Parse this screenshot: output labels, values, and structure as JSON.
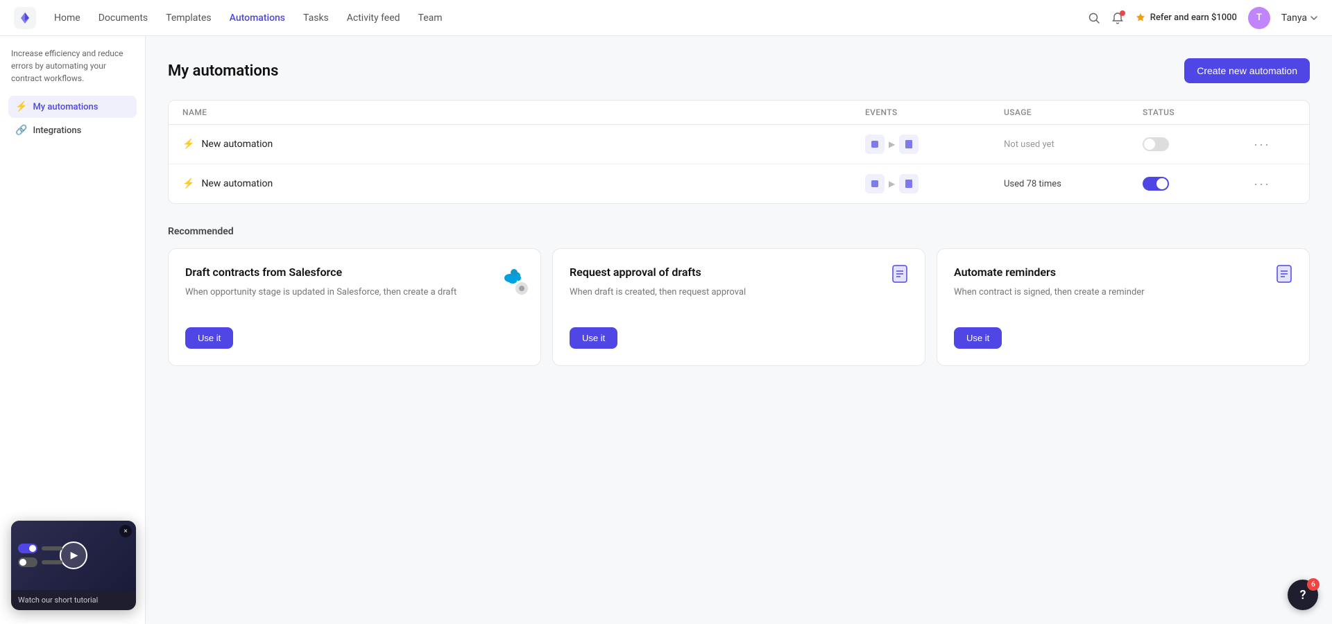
{
  "nav": {
    "links": [
      {
        "id": "home",
        "label": "Home",
        "active": false
      },
      {
        "id": "documents",
        "label": "Documents",
        "active": false
      },
      {
        "id": "templates",
        "label": "Templates",
        "active": false
      },
      {
        "id": "automations",
        "label": "Automations",
        "active": true
      },
      {
        "id": "tasks",
        "label": "Tasks",
        "active": false
      },
      {
        "id": "activity-feed",
        "label": "Activity feed",
        "active": false
      },
      {
        "id": "team",
        "label": "Team",
        "active": false
      }
    ],
    "refer": "Refer and earn $1000",
    "user": "Tanya"
  },
  "sidebar": {
    "promo": "Increase efficiency and reduce errors by automating your contract workflows.",
    "items": [
      {
        "id": "my-automations",
        "label": "My automations",
        "icon": "⚡",
        "active": true
      },
      {
        "id": "integrations",
        "label": "Integrations",
        "icon": "🔗",
        "active": false
      }
    ]
  },
  "page": {
    "title": "My automations",
    "create_btn": "Create new automation"
  },
  "table": {
    "headers": [
      "Name",
      "Events",
      "Usage",
      "Status",
      ""
    ],
    "rows": [
      {
        "name": "New automation",
        "usage": "Not used yet",
        "status": "off"
      },
      {
        "name": "New automation",
        "usage": "Used 78 times",
        "status": "on"
      }
    ]
  },
  "recommended": {
    "section_title": "Recommended",
    "cards": [
      {
        "id": "draft-salesforce",
        "title": "Draft contracts from Salesforce",
        "desc": "When opportunity stage is updated in Salesforce, then create a draft",
        "btn": "Use it",
        "icon_type": "salesforce"
      },
      {
        "id": "request-approval",
        "title": "Request approval of drafts",
        "desc": "When draft is created, then request approval",
        "btn": "Use it",
        "icon_type": "document"
      },
      {
        "id": "automate-reminders",
        "title": "Automate reminders",
        "desc": "When contract is signed, then create a reminder",
        "btn": "Use it",
        "icon_type": "document-blue"
      }
    ]
  },
  "video_widget": {
    "label": "Watch our short tutorial",
    "close": "×"
  },
  "chat": {
    "badge": "6",
    "question": "?"
  }
}
